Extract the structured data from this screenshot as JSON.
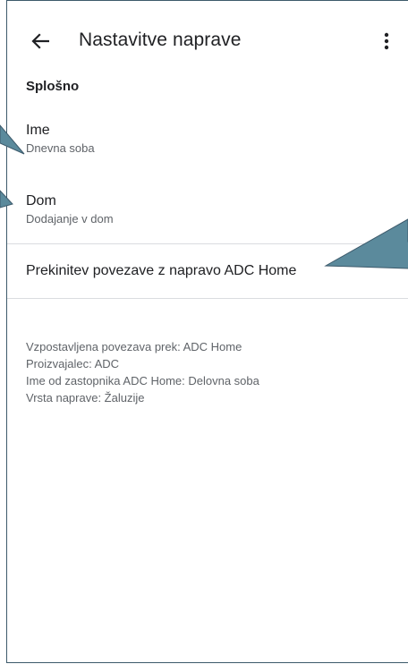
{
  "header": {
    "title": "Nastavitve naprave",
    "back_icon": "arrow-back-icon",
    "more_icon": "more-vert-icon"
  },
  "section": {
    "title": "Splošno"
  },
  "settings": [
    {
      "label": "Ime",
      "value": "Dnevna soba"
    },
    {
      "label": "Dom",
      "value": "Dodajanje v dom"
    }
  ],
  "disconnect": {
    "label": "Prekinitev povezave z napravo ADC Home"
  },
  "info": [
    "Vzpostavljena povezava prek: ADC Home",
    "Proizvajalec: ADC",
    "Ime od zastopnika ADC Home: Delovna soba",
    "Vrsta naprave: Žaluzije"
  ],
  "colors": {
    "callout_fill": "#5b8a9c",
    "callout_stroke": "#3d5a6b",
    "text_primary": "#202124",
    "text_secondary": "#5f6368",
    "divider": "#dadce0"
  }
}
